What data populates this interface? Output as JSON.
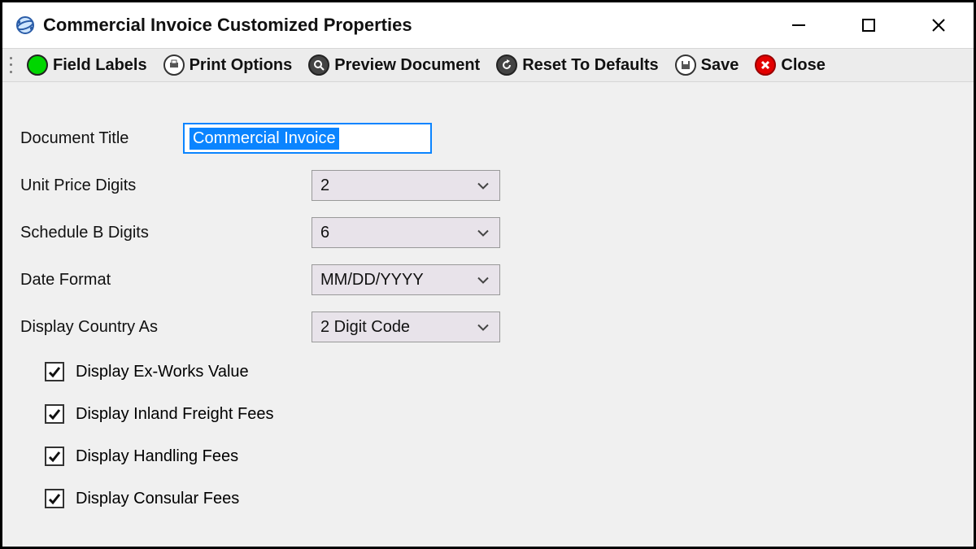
{
  "window": {
    "title": "Commercial Invoice Customized Properties"
  },
  "toolbar": {
    "field_labels": "Field Labels",
    "print_options": "Print Options",
    "preview_document": "Preview Document",
    "reset_to_defaults": "Reset To Defaults",
    "save": "Save",
    "close": "Close"
  },
  "form": {
    "document_title_label": "Document Title",
    "document_title_value": "Commercial Invoice",
    "unit_price_digits_label": "Unit Price Digits",
    "unit_price_digits_value": "2",
    "schedule_b_digits_label": "Schedule B Digits",
    "schedule_b_digits_value": "6",
    "date_format_label": "Date Format",
    "date_format_value": "MM/DD/YYYY",
    "display_country_as_label": "Display Country As",
    "display_country_as_value": "2 Digit Code"
  },
  "checks": {
    "ex_works": "Display Ex-Works Value",
    "inland_freight": "Display Inland Freight Fees",
    "handling": "Display Handling Fees",
    "consular": "Display Consular Fees"
  }
}
